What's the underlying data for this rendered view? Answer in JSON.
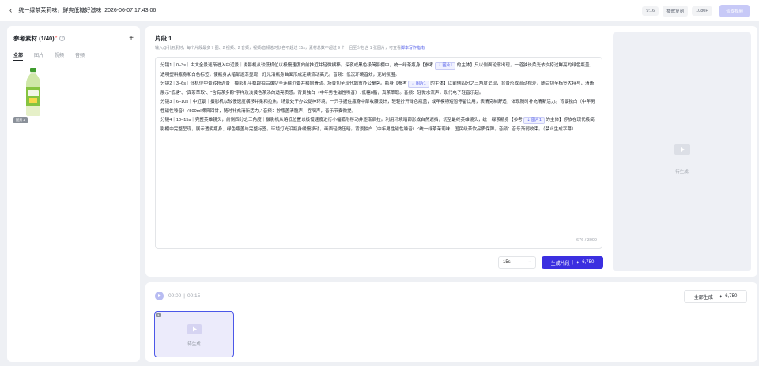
{
  "header": {
    "back_icon": "arrow-left-icon",
    "title": "统一绿茶茉莉味，鲜爽低糖好滋味_2026-06-07 17:43:06",
    "ratio": "9:16",
    "voice": "播歌复刻",
    "resolution": "1080P",
    "compose_label": "合成视频"
  },
  "materials": {
    "title": "参考素材 (1/40)",
    "required_mark": "*",
    "tabs": [
      "全部",
      "图片",
      "视频",
      "音频"
    ],
    "items": [
      {
        "tag": "图片1"
      }
    ]
  },
  "segment": {
    "title": "片段 1",
    "description": "输入@引用素材，每个片段最多 7 图、2 视频、2 音频，视频/音频总时长各不超过 15s，素材总数不超过 9 个，且至少包含 1 张图片，可查看",
    "guide_link": "脚本写作指南",
    "ref_label": "图片1",
    "shots": [
      {
        "a": "分镜1｜0–3s｜由大全景逐渐进入中近景｜摄影机从较低机位以极慢速度向前推近并轻微横移。深夜或黑色极简影棚中，统一绿茶瓶身【参考",
        "b": "的主体】只以侧面轮廓出现，一道狭长柔光依次掠过鲜亮的绿色瓶盖、透明塑料瓶身和白色标签，使瓶身从暗部逐渐显现，灯光沿瓶身曲面形成连续流动高光。音频：低沉环境音效，克制氛围。"
      },
      {
        "a": "分镜2｜3–6s｜低机位中景转超近景｜摄影机平稳跟拍后缓切至连续近景并横向滑动。场景切至现代城市办公桌旁。瓶身【参考",
        "b": "的主体】以前侧四分之三角度呈现，背景形成流动视差，随后切至标签大特写，清晰展示“低糖”、“真茶萃取”、“含有茶多酚”字样及淡黄色茶汤的透亮质感。背景独白（中年男性磁性嗓音）:‘低糖0脂，真茶萃取。’ 音频：轻微水流声，现代电子轻音乐起。"
      },
      {
        "a": "分镜3｜6–10s｜中近景｜摄影机以较慢速度横移并柔和拉焦。场景处于办公提神环境，一只手握住瓶身中部收腰设计，轻轻拧开绿色瓶盖，成年模特短暂停留饮用，表情克制舒适，体现随时补充清新活力。背景独白（中年男性磁性嗓音）:‘500ml裸爽回甘，随时补充清新活力。’ 音频：拧瓶盖清脆声，吞咽声，音乐节奏微提。",
        "b": ""
      },
      {
        "a": "分镜4｜10–15s｜完整英雄镜头，前侧四分之三角度｜摄影机从略低位置以极慢速度进行小幅弧形移动并逐渐后拉。利用环境暗部形成自然遮挡，切至最终英雄镜头，统一绿茶瓶身【参考",
        "b": "的主体】停放在现代极简影棚中完整呈现，展示透明瓶身、绿色瓶盖与完整标签。环境灯光沿瓶身缓慢移动，画面轻微压暗。背景独白（中年男性磁性嗓音）:‘统一绿茶茉莉味，国民级茶饮品质保障。’ 音频：音乐渐弱收束。（禁止生成字幕）"
      }
    ],
    "char_count": "676 / 3000",
    "duration": "15s",
    "generate_label": "生成片段",
    "generate_cost": "6,750",
    "preview_label": "待生成"
  },
  "timeline": {
    "current": "00:00",
    "total": "00:15",
    "all_generate_label": "全部生成",
    "all_generate_cost": "6,750",
    "clips": [
      {
        "num": "1",
        "label": "待生成"
      }
    ]
  },
  "colors": {
    "accent": "#3b2fe0",
    "bottle_green": "#86c440",
    "preview_bg": "#eef0f5"
  }
}
